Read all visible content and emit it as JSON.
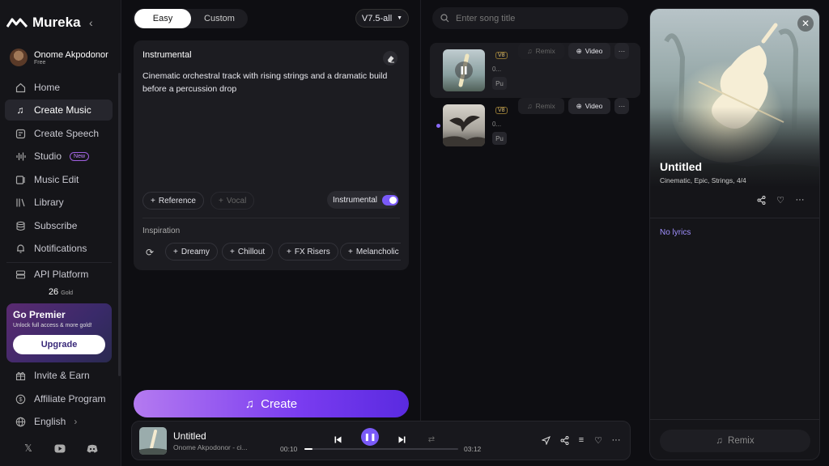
{
  "app": {
    "name": "Mureka"
  },
  "user": {
    "name": "Onome Akpodonor",
    "plan": "Free"
  },
  "nav": [
    {
      "label": "Home",
      "icon": "home-icon"
    },
    {
      "label": "Create Music",
      "icon": "music-note-icon"
    },
    {
      "label": "Create Speech",
      "icon": "speech-icon"
    },
    {
      "label": "Studio",
      "icon": "waveform-icon",
      "badge": "New"
    },
    {
      "label": "Music Edit",
      "icon": "edit-icon"
    },
    {
      "label": "Library",
      "icon": "library-icon"
    },
    {
      "label": "Subscribe",
      "icon": "coins-icon"
    },
    {
      "label": "Notifications",
      "icon": "bell-icon"
    },
    {
      "label": "API Platform",
      "icon": "api-icon"
    }
  ],
  "gold": {
    "amount": "26",
    "unit": "Gold"
  },
  "premier": {
    "title": "Go Premier",
    "subtitle": "Unlock full access & more gold!",
    "button": "Upgrade"
  },
  "footer_nav": [
    {
      "label": "Invite & Earn",
      "icon": "gift-icon"
    },
    {
      "label": "Affiliate Program",
      "icon": "dollar-icon"
    },
    {
      "label": "English",
      "icon": "globe-icon"
    }
  ],
  "social": [
    "x-icon",
    "youtube-icon",
    "discord-icon"
  ],
  "mode_tabs": {
    "easy": "Easy",
    "custom": "Custom"
  },
  "model_version": "V7.5-all",
  "prompt": {
    "title": "Instrumental",
    "text": "Cinematic orchestral track with rising strings and a dramatic build before a percussion drop",
    "reference": "Reference",
    "vocal": "Vocal",
    "instrumental_toggle": "Instrumental",
    "instrumental_on": true,
    "inspiration_label": "Inspiration",
    "inspiration_chips": [
      "Dreamy",
      "Chillout",
      "FX Risers",
      "Melancholic"
    ]
  },
  "create_button": "Create",
  "search": {
    "placeholder": "Enter song title"
  },
  "songs": [
    {
      "version": "V8",
      "duration": "0...",
      "pub": "Pu",
      "remix": "Remix",
      "video": "Video"
    },
    {
      "version": "V8",
      "duration": "0...",
      "pub": "Pu",
      "remix": "Remix",
      "video": "Video"
    }
  ],
  "detail": {
    "title": "Untitled",
    "tags": "Cinematic, Epic, Strings, 4/4",
    "lyrics": "No lyrics",
    "remix": "Remix"
  },
  "player": {
    "title": "Untitled",
    "author": "Onome Akpodonor - ci...",
    "current": "00:10",
    "total": "03:12",
    "progress": 0.05
  },
  "colors": {
    "accent": "#7a5af8",
    "background": "#0e0e12",
    "panel": "#1c1c21"
  }
}
